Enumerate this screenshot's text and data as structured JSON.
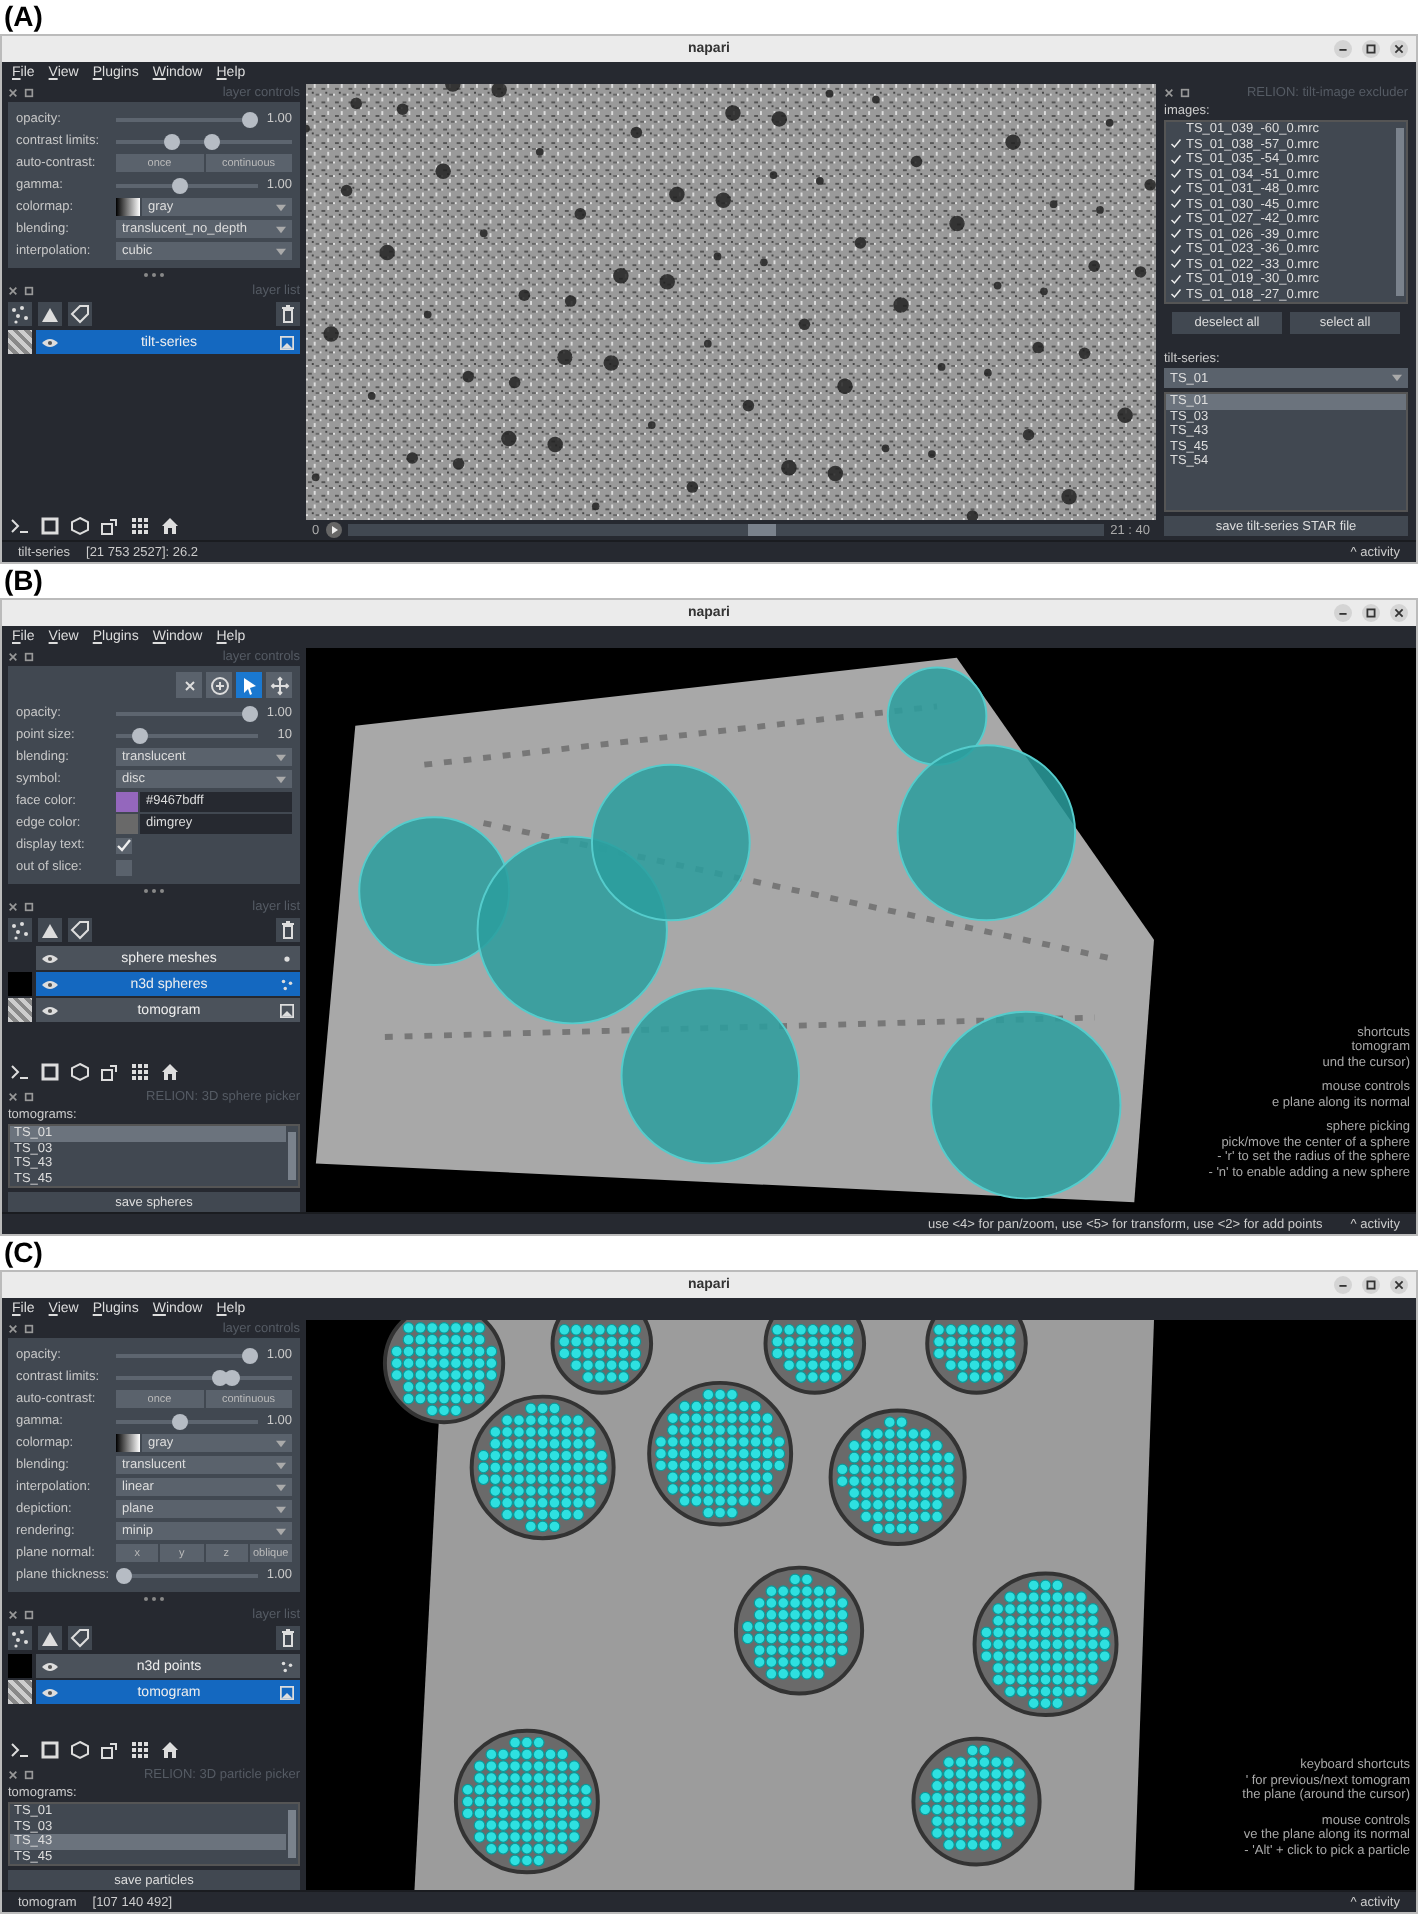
{
  "panels": [
    {
      "label": "(A)",
      "window": {
        "title": "napari"
      },
      "menu": [
        "File",
        "View",
        "Plugins",
        "Window",
        "Help"
      ],
      "layer_controls": {
        "title": "layer controls",
        "rows": [
          {
            "kind": "slider",
            "label": "opacity:",
            "level": 1,
            "value": "1.00"
          },
          {
            "kind": "range",
            "label": "contrast limits:",
            "level": [
              0.3,
              0.55
            ]
          },
          {
            "kind": "buttons",
            "label": "auto-contrast:",
            "options": [
              "once",
              "continuous"
            ]
          },
          {
            "kind": "slider",
            "label": "gamma:",
            "level": 0.45,
            "value": "1.00"
          },
          {
            "kind": "colormap",
            "label": "colormap:",
            "value": "gray"
          },
          {
            "kind": "dropdown",
            "label": "blending:",
            "value": "translucent_no_depth"
          },
          {
            "kind": "dropdown",
            "label": "interpolation:",
            "value": "cubic"
          }
        ]
      },
      "layer_list": {
        "title": "layer list",
        "layers": [
          {
            "name": "tilt-series",
            "kind": "image",
            "selected": true
          }
        ]
      },
      "canvas": {
        "kind": "micrograph",
        "dims": {
          "start": "0",
          "level": 0.55,
          "reading": "21 : 40"
        }
      },
      "right_dock": {
        "title": "RELION: tilt-image excluder",
        "images_label": "images:",
        "images": [
          {
            "name": "TS_01_039_-60_0.mrc",
            "checked": false
          },
          {
            "name": "TS_01_038_-57_0.mrc",
            "checked": true
          },
          {
            "name": "TS_01_035_-54_0.mrc",
            "checked": true
          },
          {
            "name": "TS_01_034_-51_0.mrc",
            "checked": true
          },
          {
            "name": "TS_01_031_-48_0.mrc",
            "checked": true
          },
          {
            "name": "TS_01_030_-45_0.mrc",
            "checked": true
          },
          {
            "name": "TS_01_027_-42_0.mrc",
            "checked": true
          },
          {
            "name": "TS_01_026_-39_0.mrc",
            "checked": true
          },
          {
            "name": "TS_01_023_-36_0.mrc",
            "checked": true
          },
          {
            "name": "TS_01_022_-33_0.mrc",
            "checked": true
          },
          {
            "name": "TS_01_019_-30_0.mrc",
            "checked": true
          },
          {
            "name": "TS_01_018_-27_0.mrc",
            "checked": true
          }
        ],
        "buttons": [
          "deselect all",
          "select all"
        ],
        "series_label": "tilt-series:",
        "dropdown": "TS_01",
        "series": [
          {
            "name": "TS_01",
            "selected": true
          },
          {
            "name": "TS_03",
            "selected": false
          },
          {
            "name": "TS_43",
            "selected": false
          },
          {
            "name": "TS_45",
            "selected": false
          },
          {
            "name": "TS_54",
            "selected": false
          }
        ],
        "save": "save tilt-series STAR file"
      },
      "status": {
        "layer": "tilt-series",
        "position": "[21 753 2527]: 26.2",
        "activity": "^ activity"
      }
    },
    {
      "label": "(B)",
      "window": {
        "title": "napari"
      },
      "menu": [
        "File",
        "View",
        "Plugins",
        "Window",
        "Help"
      ],
      "layer_controls": {
        "title": "layer controls",
        "modes": [
          {
            "kind": "delete",
            "selected": false
          },
          {
            "kind": "add",
            "selected": false
          },
          {
            "kind": "select",
            "selected": true
          },
          {
            "kind": "pan",
            "selected": false
          }
        ],
        "rows": [
          {
            "kind": "slider",
            "label": "opacity:",
            "level": 1,
            "value": "1.00"
          },
          {
            "kind": "slider",
            "label": "point size:",
            "level": 0.12,
            "value": "10"
          },
          {
            "kind": "dropdown",
            "label": "blending:",
            "value": "translucent"
          },
          {
            "kind": "dropdown",
            "label": "symbol:",
            "value": "disc"
          },
          {
            "kind": "color",
            "label": "face color:",
            "color": "#9467bd",
            "value": "#9467bdff"
          },
          {
            "kind": "color",
            "label": "edge color:",
            "color": "#696969",
            "value": "dimgrey"
          },
          {
            "kind": "checkbox",
            "label": "display text:",
            "checked": true
          },
          {
            "kind": "checkbox",
            "label": "out of slice:",
            "checked": false
          }
        ]
      },
      "layer_list": {
        "title": "layer list",
        "layers": [
          {
            "name": "sphere meshes",
            "kind": "surface",
            "selected": false
          },
          {
            "name": "n3d spheres",
            "kind": "points",
            "selected": true
          },
          {
            "name": "tomogram",
            "kind": "image",
            "selected": false
          }
        ]
      },
      "dock_widget": {
        "title": "RELION: 3D sphere picker",
        "label": "tomograms:",
        "items": [
          {
            "name": "TS_01",
            "selected": true
          },
          {
            "name": "TS_03",
            "selected": false
          },
          {
            "name": "TS_43",
            "selected": false
          },
          {
            "name": "TS_45",
            "selected": false
          }
        ],
        "button": "save spheres"
      },
      "canvas": {
        "kind": "spheres",
        "help": [
          [
            "shortcuts",
            "tomogram",
            "und the cursor)"
          ],
          [
            "mouse controls",
            "e plane along its normal"
          ],
          [
            "sphere picking",
            "pick/move the center of a sphere",
            "- 'r' to set the radius of the sphere",
            "- 'n' to enable adding a new sphere"
          ]
        ]
      },
      "status": {
        "hint": "use <4> for pan/zoom, use <5> for transform, use <2> for add points",
        "activity": "^ activity"
      }
    },
    {
      "label": "(C)",
      "window": {
        "title": "napari"
      },
      "menu": [
        "File",
        "View",
        "Plugins",
        "Window",
        "Help"
      ],
      "layer_controls": {
        "title": "layer controls",
        "rows": [
          {
            "kind": "slider",
            "label": "opacity:",
            "level": 1,
            "value": "1.00"
          },
          {
            "kind": "range",
            "label": "contrast limits:",
            "level": [
              0.6,
              0.68
            ]
          },
          {
            "kind": "buttons",
            "label": "auto-contrast:",
            "options": [
              "once",
              "continuous"
            ]
          },
          {
            "kind": "slider",
            "label": "gamma:",
            "level": 0.45,
            "value": "1.00"
          },
          {
            "kind": "colormap",
            "label": "colormap:",
            "value": "gray"
          },
          {
            "kind": "dropdown",
            "label": "blending:",
            "value": "translucent"
          },
          {
            "kind": "dropdown",
            "label": "interpolation:",
            "value": "linear"
          },
          {
            "kind": "dropdown",
            "label": "depiction:",
            "value": "plane"
          },
          {
            "kind": "dropdown",
            "label": "rendering:",
            "value": "minip"
          },
          {
            "kind": "buttons",
            "label": "plane normal:",
            "options": [
              "x",
              "y",
              "z",
              "oblique"
            ]
          },
          {
            "kind": "slider",
            "label": "plane thickness:",
            "level": 0,
            "value": "1.00"
          }
        ]
      },
      "layer_list": {
        "title": "layer list",
        "layers": [
          {
            "name": "n3d points",
            "kind": "points",
            "selected": false
          },
          {
            "name": "tomogram",
            "kind": "image",
            "selected": true
          }
        ]
      },
      "dock_widget": {
        "title": "RELION: 3D particle picker",
        "label": "tomograms:",
        "items": [
          {
            "name": "TS_01",
            "selected": false
          },
          {
            "name": "TS_03",
            "selected": false
          },
          {
            "name": "TS_43",
            "selected": true
          },
          {
            "name": "TS_45",
            "selected": false
          }
        ],
        "button": "save particles"
      },
      "canvas": {
        "kind": "particles",
        "help": [
          [
            "keyboard shortcuts",
            "' for previous/next tomogram",
            "the plane (around the cursor)"
          ],
          [
            "mouse controls",
            "ve the plane along its normal",
            "- 'Alt' + click to pick a particle"
          ]
        ]
      },
      "status": {
        "layer": "tomogram",
        "position": "[107 140 492]",
        "activity": "^ activity"
      }
    }
  ]
}
